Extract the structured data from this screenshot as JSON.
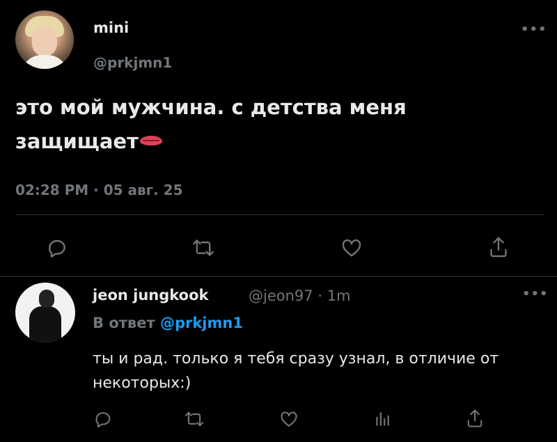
{
  "main_tweet": {
    "author_name": "mini",
    "author_handle": "@prkjmn1",
    "text": "это мой мужчина. с детства меня защищает",
    "emoji": "lips-emoji",
    "timestamp": "02:28 PM · 05 авг. 25",
    "more": "•••",
    "actions": [
      "reply-icon",
      "retweet-icon",
      "like-icon",
      "share-icon"
    ]
  },
  "reply_tweet": {
    "author_name": "jeon jungkook",
    "author_handle": "@jeon97",
    "time": "1m",
    "separator": "·",
    "reply_prefix": "В ответ",
    "reply_mention": "@prkjmn1",
    "text": "ты и рад. только я тебя сразу узнал, в отличие от некоторых:)",
    "more": "•••",
    "actions": [
      "reply-icon",
      "retweet-icon",
      "like-icon",
      "analytics-icon",
      "share-icon"
    ]
  },
  "colors": {
    "background": "#000000",
    "text": "#e7e9ea",
    "secondary": "#71767b",
    "accent": "#1d9bf0",
    "divider": "#2f3336"
  }
}
